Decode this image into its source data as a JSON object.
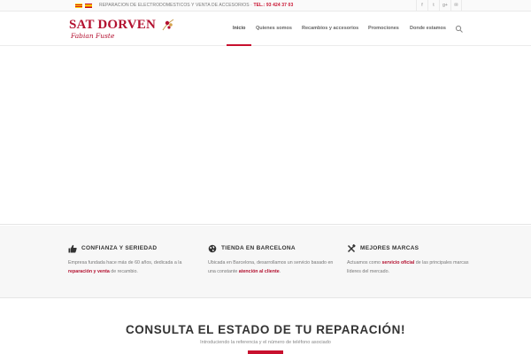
{
  "topbar": {
    "info_text": "REPARACION DE ELECTRODOMESTICOS Y VENTA DE ACCESORIOS · ",
    "phone": "TEL.: 93 424 37 03",
    "languages": [
      "catalan-flag",
      "spanish-flag"
    ],
    "social": [
      {
        "name": "facebook-icon",
        "glyph": "f"
      },
      {
        "name": "twitter-icon",
        "glyph": "t"
      },
      {
        "name": "google-plus-icon",
        "glyph": "g+"
      },
      {
        "name": "mail-icon",
        "glyph": "✉"
      }
    ]
  },
  "header": {
    "logo_text": "SAT DORVEN",
    "logo_tagline": "Fabian Fuste"
  },
  "nav": {
    "items": [
      {
        "label": "Inicio",
        "active": true
      },
      {
        "label": "Quienes somos"
      },
      {
        "label": "Recambios y accesorios"
      },
      {
        "label": "Promociones"
      },
      {
        "label": "Donde estamos"
      }
    ]
  },
  "features": [
    {
      "icon": "thumbs-up-icon",
      "title": "CONFIANZA Y SERIEDAD",
      "text_a": "Empresa fundada hace más de 60 años, dedicada a la ",
      "highlight": "reparación y venta",
      "text_b": " de recambio."
    },
    {
      "icon": "globe-icon",
      "title": "TIENDA EN BARCELONA",
      "text_a": "Ubicada en Barcelona, desarrollamos un servicio basado en una constante ",
      "highlight": "atención al cliente",
      "text_b": "."
    },
    {
      "icon": "tools-icon",
      "title": "MEJORES MARCAS",
      "text_a": "Actuamos como ",
      "highlight": "servicio oficial",
      "text_b": " de las principales marcas líderes del mercado."
    }
  ],
  "consulta": {
    "title": "CONSULTA EL ESTADO DE TU REPARACIÓN!",
    "subtitle": "Introduciendo la referencia y el número de teléfono asociado"
  },
  "colors": {
    "accent": "#c8102e",
    "brand": "#b3102f"
  }
}
